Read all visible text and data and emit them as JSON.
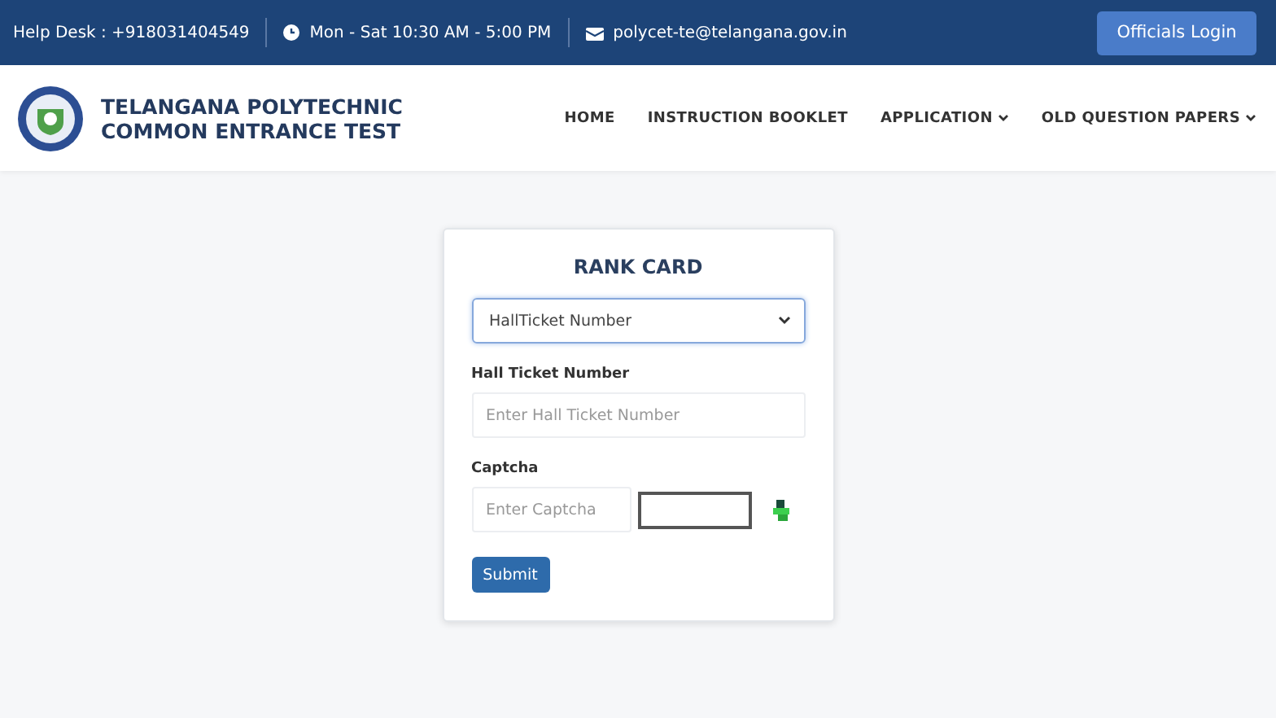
{
  "top_bar": {
    "helpdesk": "Help Desk : +918031404549",
    "hours": "Mon - Sat  10:30 AM - 5:00 PM",
    "email": "polycet-te@telangana.gov.in",
    "login_button": "Officials Login"
  },
  "header": {
    "title_line_1": "TELANGANA POLYTECHNIC",
    "title_line_2": "COMMON ENTRANCE TEST",
    "nav": [
      {
        "label": "HOME",
        "kind": "link"
      },
      {
        "label": "INSTRUCTION BOOKLET",
        "kind": "link"
      },
      {
        "label": "APPLICATION",
        "kind": "dropdown"
      },
      {
        "label": "OLD QUESTION PAPERS",
        "kind": "dropdown"
      }
    ]
  },
  "rank_card": {
    "title": "RANK CARD",
    "search_by": "HallTicket Number",
    "hall_ticket_label": "Hall Ticket Number",
    "hall_ticket_placeholder": "Enter Hall Ticket Number",
    "captcha_label": "Captcha",
    "captcha_placeholder": "Enter Captcha",
    "submit": "Submit"
  }
}
